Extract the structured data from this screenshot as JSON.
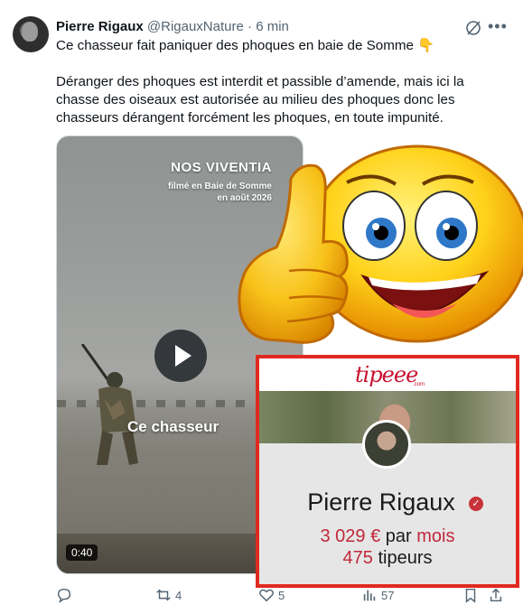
{
  "tweet": {
    "author_name": "Pierre Rigaux",
    "handle": "@RigauxNature",
    "separator": "·",
    "time": "6 min",
    "text_line1": "Ce chasseur fait paniquer des phoques en baie de Somme 👇",
    "text_para2": "Déranger des phoques est interdit et passible d’amende, mais ici la chasse des oiseaux est autorisée au milieu des phoques donc les chasseurs dérangent forcément les phoques, en toute impunité."
  },
  "video": {
    "title": "NOS VIVENTIA",
    "subtitle_line1": "filmé en Baie de Somme",
    "subtitle_line2": "en août 2026",
    "caption": "Ce chasseur",
    "duration": "0:40"
  },
  "tipeee": {
    "logo": "tipeee",
    "logo_suffix": ".com",
    "name": "Pierre Rigaux",
    "amount_value": "3 029 €",
    "amount_middle": "par",
    "amount_period": "mois",
    "tipers_count": "475",
    "tipers_label": "tipeurs",
    "accent_color": "#c0283a",
    "frame_color": "#e0291f"
  },
  "actions": {
    "reply_count": "",
    "retweet_count": "4",
    "like_count": "5",
    "views_count": "57"
  },
  "icons": [
    "grok-icon",
    "more-icon",
    "play-icon",
    "reply-icon",
    "retweet-icon",
    "like-icon",
    "views-icon",
    "bookmark-icon",
    "share-icon",
    "thumbs-up-emoji",
    "verified-icon"
  ]
}
